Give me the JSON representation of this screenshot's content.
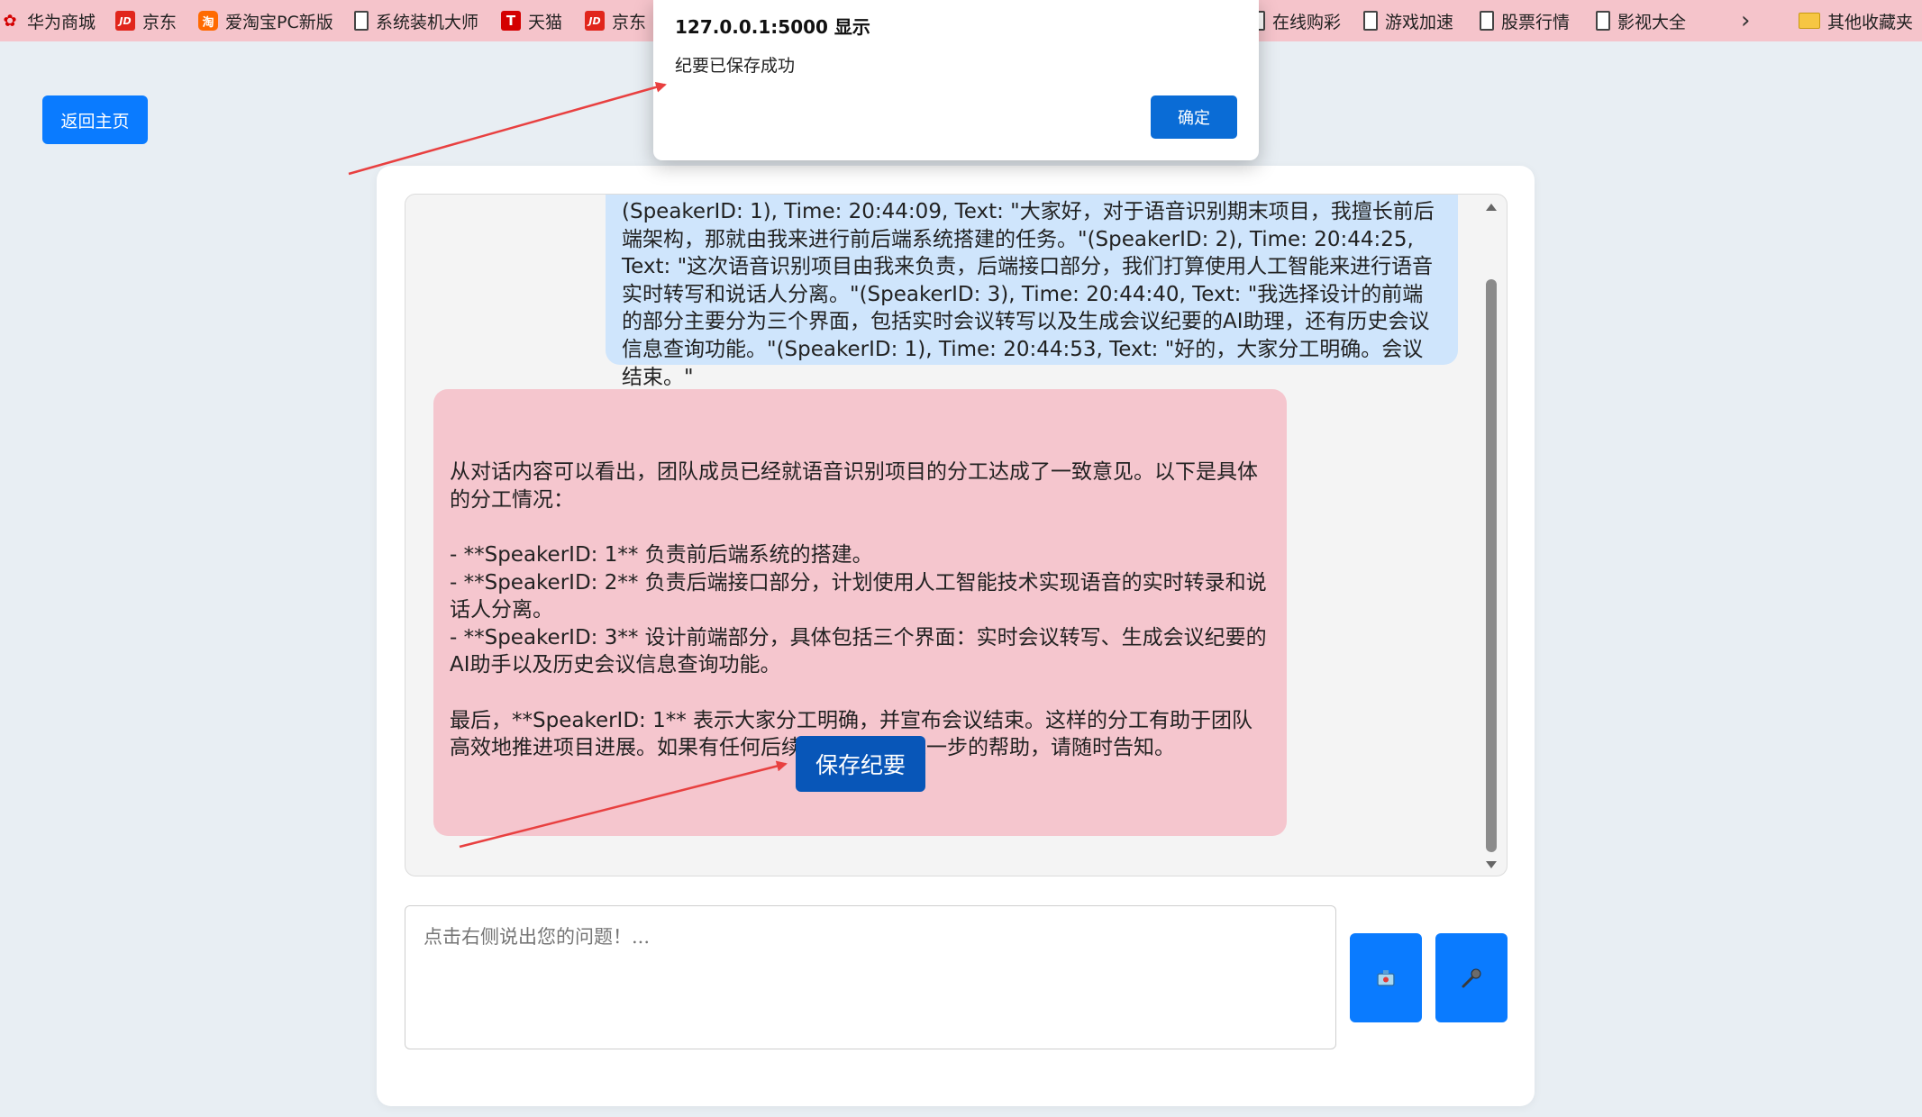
{
  "bookmarks": [
    {
      "label": "华为商城",
      "icon": "huawei-icon"
    },
    {
      "label": "京东",
      "icon": "jd-icon"
    },
    {
      "label": "爱淘宝PC新版",
      "icon": "taobao-icon"
    },
    {
      "label": "系统装机大师",
      "icon": "page-icon"
    },
    {
      "label": "天猫",
      "icon": "tmall-icon"
    },
    {
      "label": "京东",
      "icon": "jd-icon"
    },
    {
      "label": "在线购彩",
      "icon": "page-icon"
    },
    {
      "label": "游戏加速",
      "icon": "page-icon"
    },
    {
      "label": "股票行情",
      "icon": "page-icon"
    },
    {
      "label": "影视大全",
      "icon": "page-icon"
    },
    {
      "label": "其他收藏夹",
      "icon": "folder-icon"
    }
  ],
  "home_button": "返回主页",
  "dialog": {
    "title": "127.0.0.1:5000 显示",
    "message": "纪要已保存成功",
    "ok_label": "确定"
  },
  "chat": {
    "user_message": "(SpeakerID: 1), Time: 20:44:09, Text: \"大家好，对于语音识别期末项目，我擅长前后端架构，那就由我来进行前后端系统搭建的任务。\"(SpeakerID: 2), Time: 20:44:25, Text: \"这次语音识别项目由我来负责，后端接口部分，我们打算使用人工智能来进行语音实时转写和说话人分离。\"(SpeakerID: 3), Time: 20:44:40, Text: \"我选择设计的前端的部分主要分为三个界面，包括实时会议转写以及生成会议纪要的AI助理，还有历史会议信息查询功能。\"(SpeakerID: 1), Time: 20:44:53, Text: \"好的，大家分工明确。会议结束。\"",
    "ai_message": "从对话内容可以看出，团队成员已经就语音识别项目的分工达成了一致意见。以下是具体的分工情况：\n\n- **SpeakerID: 1** 负责前后端系统的搭建。\n- **SpeakerID: 2** 负责后端接口部分，计划使用人工智能技术实现语音的实时转录和说话人分离。\n- **SpeakerID: 3** 设计前端部分，具体包括三个界面：实时会议转写、生成会议纪要的AI助手以及历史会议信息查询功能。\n\n最后，**SpeakerID: 1** 表示大家分工明确，并宣布会议结束。这样的分工有助于团队高效地推进项目进展。如果有任何后续问题或需要进一步的帮助，请随时告知。",
    "save_button": "保存纪要"
  },
  "input": {
    "placeholder": "点击右侧说出您的问题！..."
  },
  "colors": {
    "accent": "#0a7bff",
    "save_button": "#0856b8",
    "user_bubble": "#cfe5fc",
    "ai_bubble": "#f5c6ce",
    "bookmarks_bar": "#f5c4cb",
    "arrow": "#e84040"
  }
}
